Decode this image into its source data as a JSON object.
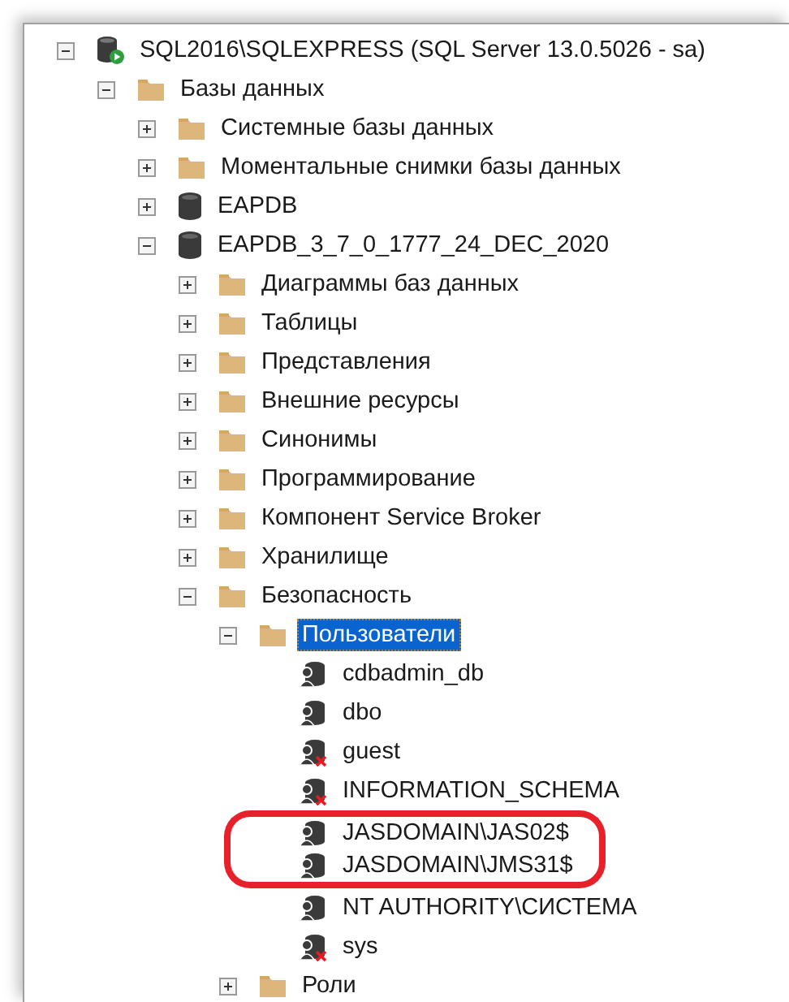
{
  "tree": [
    {
      "label": "SQL2016\\SQLEXPRESS (SQL Server 13.0.5026 - sa)",
      "kind": "server",
      "expanded": true,
      "selected": false,
      "children": [
        {
          "label": "Базы данных",
          "kind": "folder",
          "expanded": true,
          "selected": false,
          "children": [
            {
              "label": "Системные базы данных",
              "kind": "folder",
              "expanded": false,
              "selected": false
            },
            {
              "label": "Моментальные снимки базы данных",
              "kind": "folder",
              "expanded": false,
              "selected": false
            },
            {
              "label": "EAPDB",
              "kind": "database",
              "expanded": false,
              "selected": false
            },
            {
              "label": "EAPDB_3_7_0_1777_24_DEC_2020",
              "kind": "database",
              "expanded": true,
              "selected": false,
              "children": [
                {
                  "label": "Диаграммы баз данных",
                  "kind": "folder",
                  "expanded": false,
                  "selected": false
                },
                {
                  "label": "Таблицы",
                  "kind": "folder",
                  "expanded": false,
                  "selected": false
                },
                {
                  "label": "Представления",
                  "kind": "folder",
                  "expanded": false,
                  "selected": false
                },
                {
                  "label": "Внешние ресурсы",
                  "kind": "folder",
                  "expanded": false,
                  "selected": false
                },
                {
                  "label": "Синонимы",
                  "kind": "folder",
                  "expanded": false,
                  "selected": false
                },
                {
                  "label": "Программирование",
                  "kind": "folder",
                  "expanded": false,
                  "selected": false
                },
                {
                  "label": "Компонент Service Broker",
                  "kind": "folder",
                  "expanded": false,
                  "selected": false
                },
                {
                  "label": "Хранилище",
                  "kind": "folder",
                  "expanded": false,
                  "selected": false
                },
                {
                  "label": "Безопасность",
                  "kind": "folder",
                  "expanded": true,
                  "selected": false,
                  "children": [
                    {
                      "label": "Пользователи",
                      "kind": "folder",
                      "expanded": true,
                      "selected": true,
                      "children": [
                        {
                          "label": "cdbadmin_db",
                          "kind": "user",
                          "selected": false,
                          "highlighted": false
                        },
                        {
                          "label": "dbo",
                          "kind": "user",
                          "selected": false,
                          "highlighted": false
                        },
                        {
                          "label": "guest",
                          "kind": "user-disabled",
                          "selected": false,
                          "highlighted": false
                        },
                        {
                          "label": "INFORMATION_SCHEMA",
                          "kind": "user-disabled",
                          "selected": false,
                          "highlighted": false
                        },
                        {
                          "label": "JASDOMAIN\\JAS02$",
                          "kind": "user",
                          "selected": false,
                          "highlighted": true
                        },
                        {
                          "label": "JASDOMAIN\\JMS31$",
                          "kind": "user",
                          "selected": false,
                          "highlighted": true
                        },
                        {
                          "label": "NT AUTHORITY\\СИСТЕМА",
                          "kind": "user",
                          "selected": false,
                          "highlighted": false
                        },
                        {
                          "label": "sys",
                          "kind": "user-disabled",
                          "selected": false,
                          "highlighted": false
                        }
                      ]
                    },
                    {
                      "label": "Роли",
                      "kind": "folder",
                      "expanded": false,
                      "selected": false
                    }
                  ]
                }
              ]
            }
          ]
        }
      ]
    }
  ]
}
